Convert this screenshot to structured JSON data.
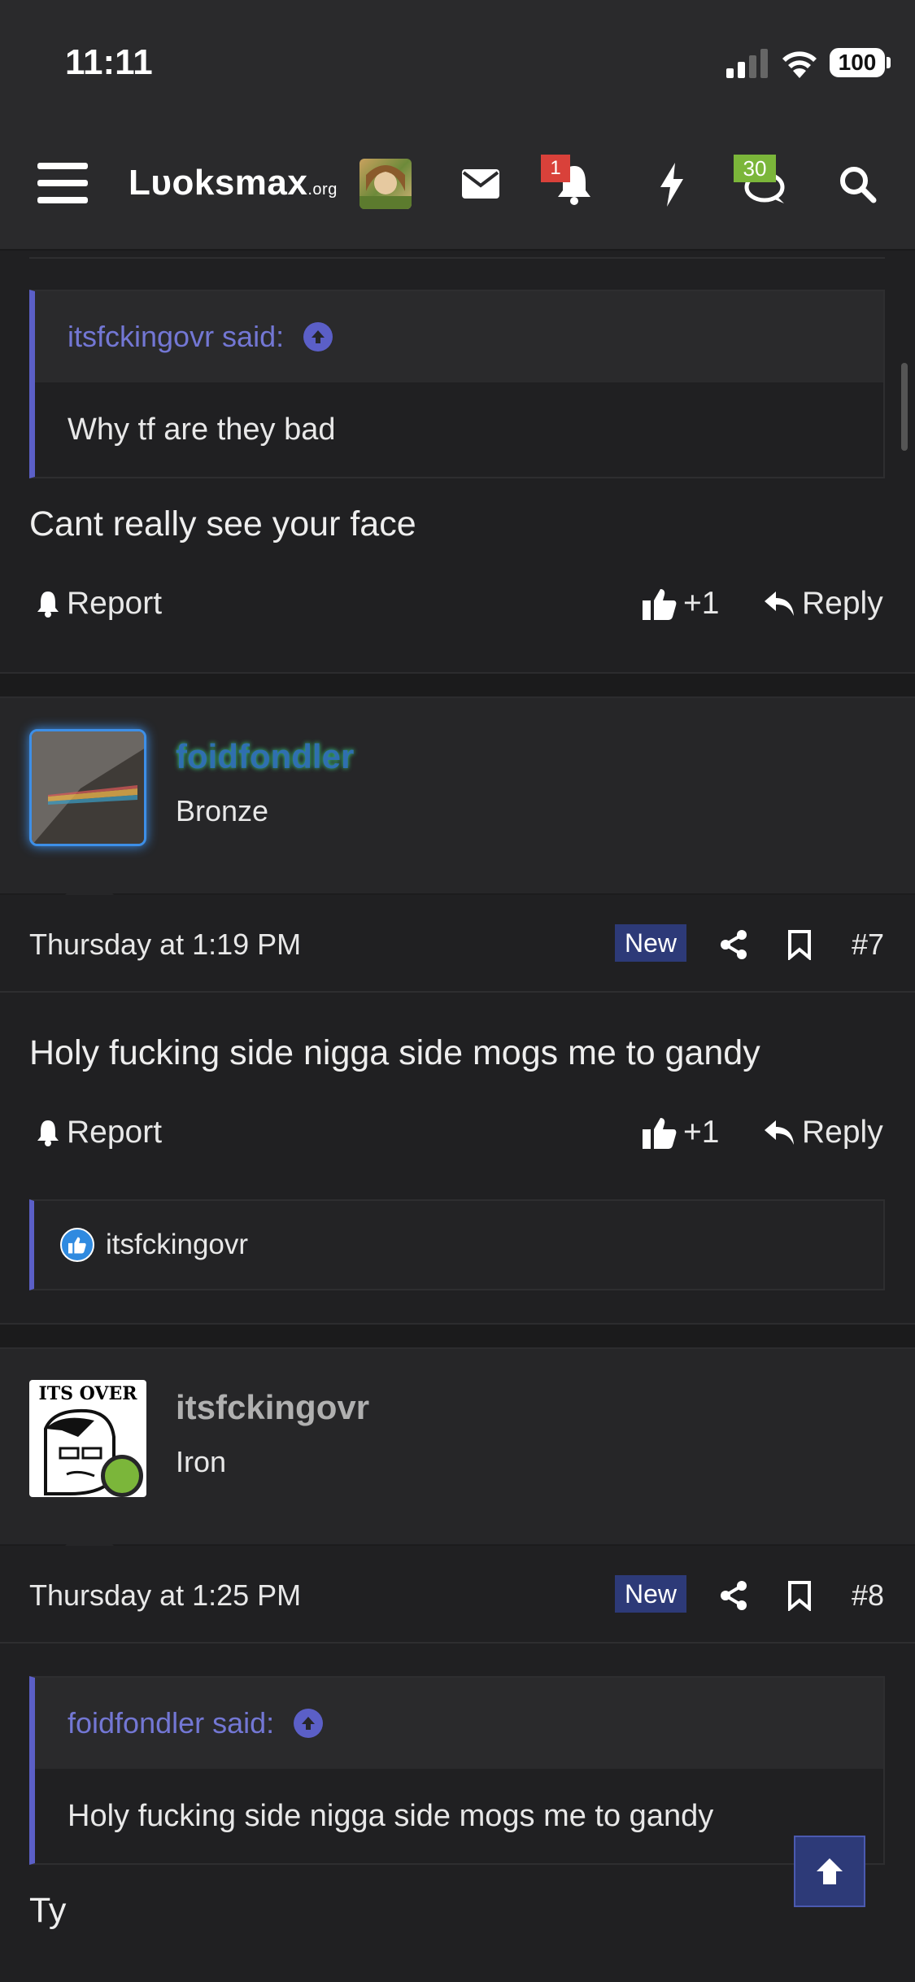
{
  "status": {
    "time": "11:11",
    "battery": "100"
  },
  "header": {
    "logo_main": "Lυoksmax",
    "logo_suffix": ".org",
    "notif_count": "1",
    "convo_count": "30"
  },
  "post6": {
    "quote_author": "itsfckingovr said:",
    "quote_text": "Why tf are they bad",
    "text": "Cant really see your face",
    "report": "Report",
    "likes": "+1",
    "reply": "Reply"
  },
  "post7": {
    "username": "foidfondler",
    "user_title": "Bronze",
    "date": "Thursday at 1:19 PM",
    "new_label": "New",
    "number": "#7",
    "text": "Holy fucking side nigga side mogs me to gandy",
    "report": "Report",
    "likes": "+1",
    "reply": "Reply",
    "reacted_by": "itsfckingovr"
  },
  "post8": {
    "username": "itsfckingovr",
    "user_title": "Iron",
    "avatar_text": "ITS OVER",
    "date": "Thursday at 1:25 PM",
    "new_label": "New",
    "number": "#8",
    "quote_author": "foidfondler said:",
    "quote_text": "Holy fucking side nigga side mogs me to gandy",
    "text": "Ty"
  },
  "colors": {
    "accent": "#5b5fc7",
    "new_badge": "#2d3a78",
    "online": "#7bb63a"
  }
}
